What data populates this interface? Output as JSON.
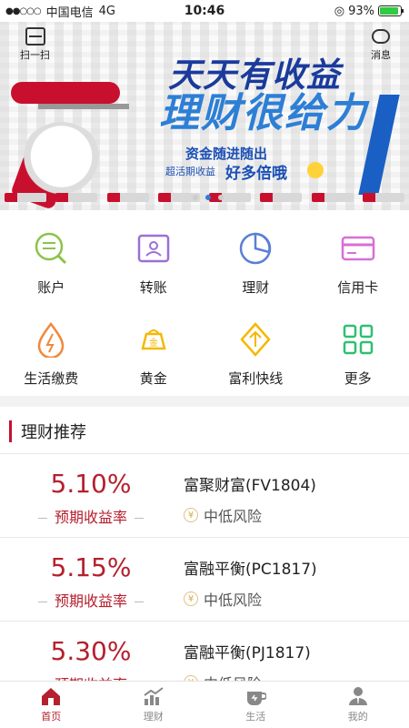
{
  "status_bar": {
    "carrier": "中国电信",
    "network": "4G",
    "time": "10:46",
    "battery": "93%",
    "battery_level": 0.93
  },
  "header": {
    "scan_label": "扫一扫",
    "message_label": "消息"
  },
  "banner": {
    "headline_top": "天天有收益",
    "headline_bottom": "理财很给力",
    "subline1": "资金随进随出",
    "subline2": "超活期收益",
    "subline3": "好多倍哦",
    "pages": 3,
    "active_page": 2
  },
  "menu": {
    "items": [
      {
        "label": "账户",
        "icon": "account-icon",
        "color": "#8bc34a"
      },
      {
        "label": "转账",
        "icon": "transfer-icon",
        "color": "#9c6fd6"
      },
      {
        "label": "理财",
        "icon": "finance-pie-icon",
        "color": "#5b7fd6"
      },
      {
        "label": "信用卡",
        "icon": "credit-card-icon",
        "color": "#d86fd6"
      },
      {
        "label": "生活缴费",
        "icon": "utility-bill-icon",
        "color": "#f0883a"
      },
      {
        "label": "黄金",
        "icon": "gold-icon",
        "color": "#f5b800"
      },
      {
        "label": "富利快线",
        "icon": "fuli-express-icon",
        "color": "#f5b800"
      },
      {
        "label": "更多",
        "icon": "more-grid-icon",
        "color": "#2fbf71"
      }
    ]
  },
  "section": {
    "title": "理财推荐"
  },
  "products": [
    {
      "rate": "5.10%",
      "rate_label": "预期收益率",
      "name": "富聚财富(FV1804)",
      "risk": "中低风险"
    },
    {
      "rate": "5.15%",
      "rate_label": "预期收益率",
      "name": "富融平衡(PC1817)",
      "risk": "中低风险"
    },
    {
      "rate": "5.30%",
      "rate_label": "预期收益率",
      "name": "富融平衡(PJ1817)",
      "risk": "中低风险"
    }
  ],
  "tabbar": {
    "items": [
      {
        "label": "首页",
        "icon": "home-icon",
        "active": true
      },
      {
        "label": "理财",
        "icon": "chart-icon",
        "active": false
      },
      {
        "label": "生活",
        "icon": "coffee-icon",
        "active": false
      },
      {
        "label": "我的",
        "icon": "profile-icon",
        "active": false
      }
    ]
  },
  "colors": {
    "accent": "#b5202e",
    "tab_inactive": "#888888"
  }
}
